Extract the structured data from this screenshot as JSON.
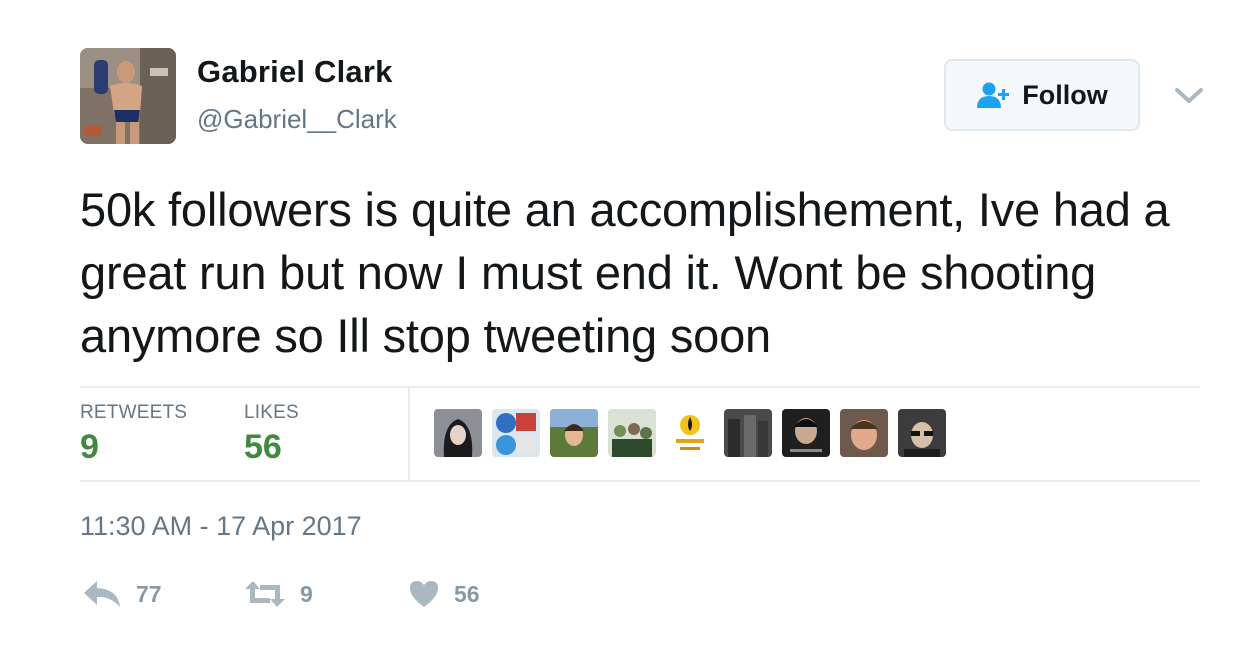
{
  "user": {
    "name": "Gabriel Clark",
    "handle": "@Gabriel__Clark"
  },
  "follow_button": {
    "label": "Follow"
  },
  "tweet": {
    "text": "50k followers is quite an accomplishement, Ive had a great run but now I must end it. Wont be shooting anymore so Ill stop tweeting soon",
    "timestamp": "11:30 AM - 17 Apr 2017"
  },
  "stats": {
    "retweets_label": "RETWEETS",
    "retweets_value": "9",
    "likes_label": "LIKES",
    "likes_value": "56"
  },
  "liker_avatars": [
    "avatar-1",
    "avatar-2",
    "avatar-3",
    "avatar-4",
    "avatar-5",
    "avatar-6",
    "avatar-7",
    "avatar-8",
    "avatar-9"
  ],
  "actions": {
    "reply_count": "77",
    "retweet_count": "9",
    "like_count": "56"
  },
  "colors": {
    "stat_value": "#3f8a3f",
    "muted_text": "#657786",
    "action_icon": "#aab8c2",
    "follow_icon": "#1da1f2"
  }
}
